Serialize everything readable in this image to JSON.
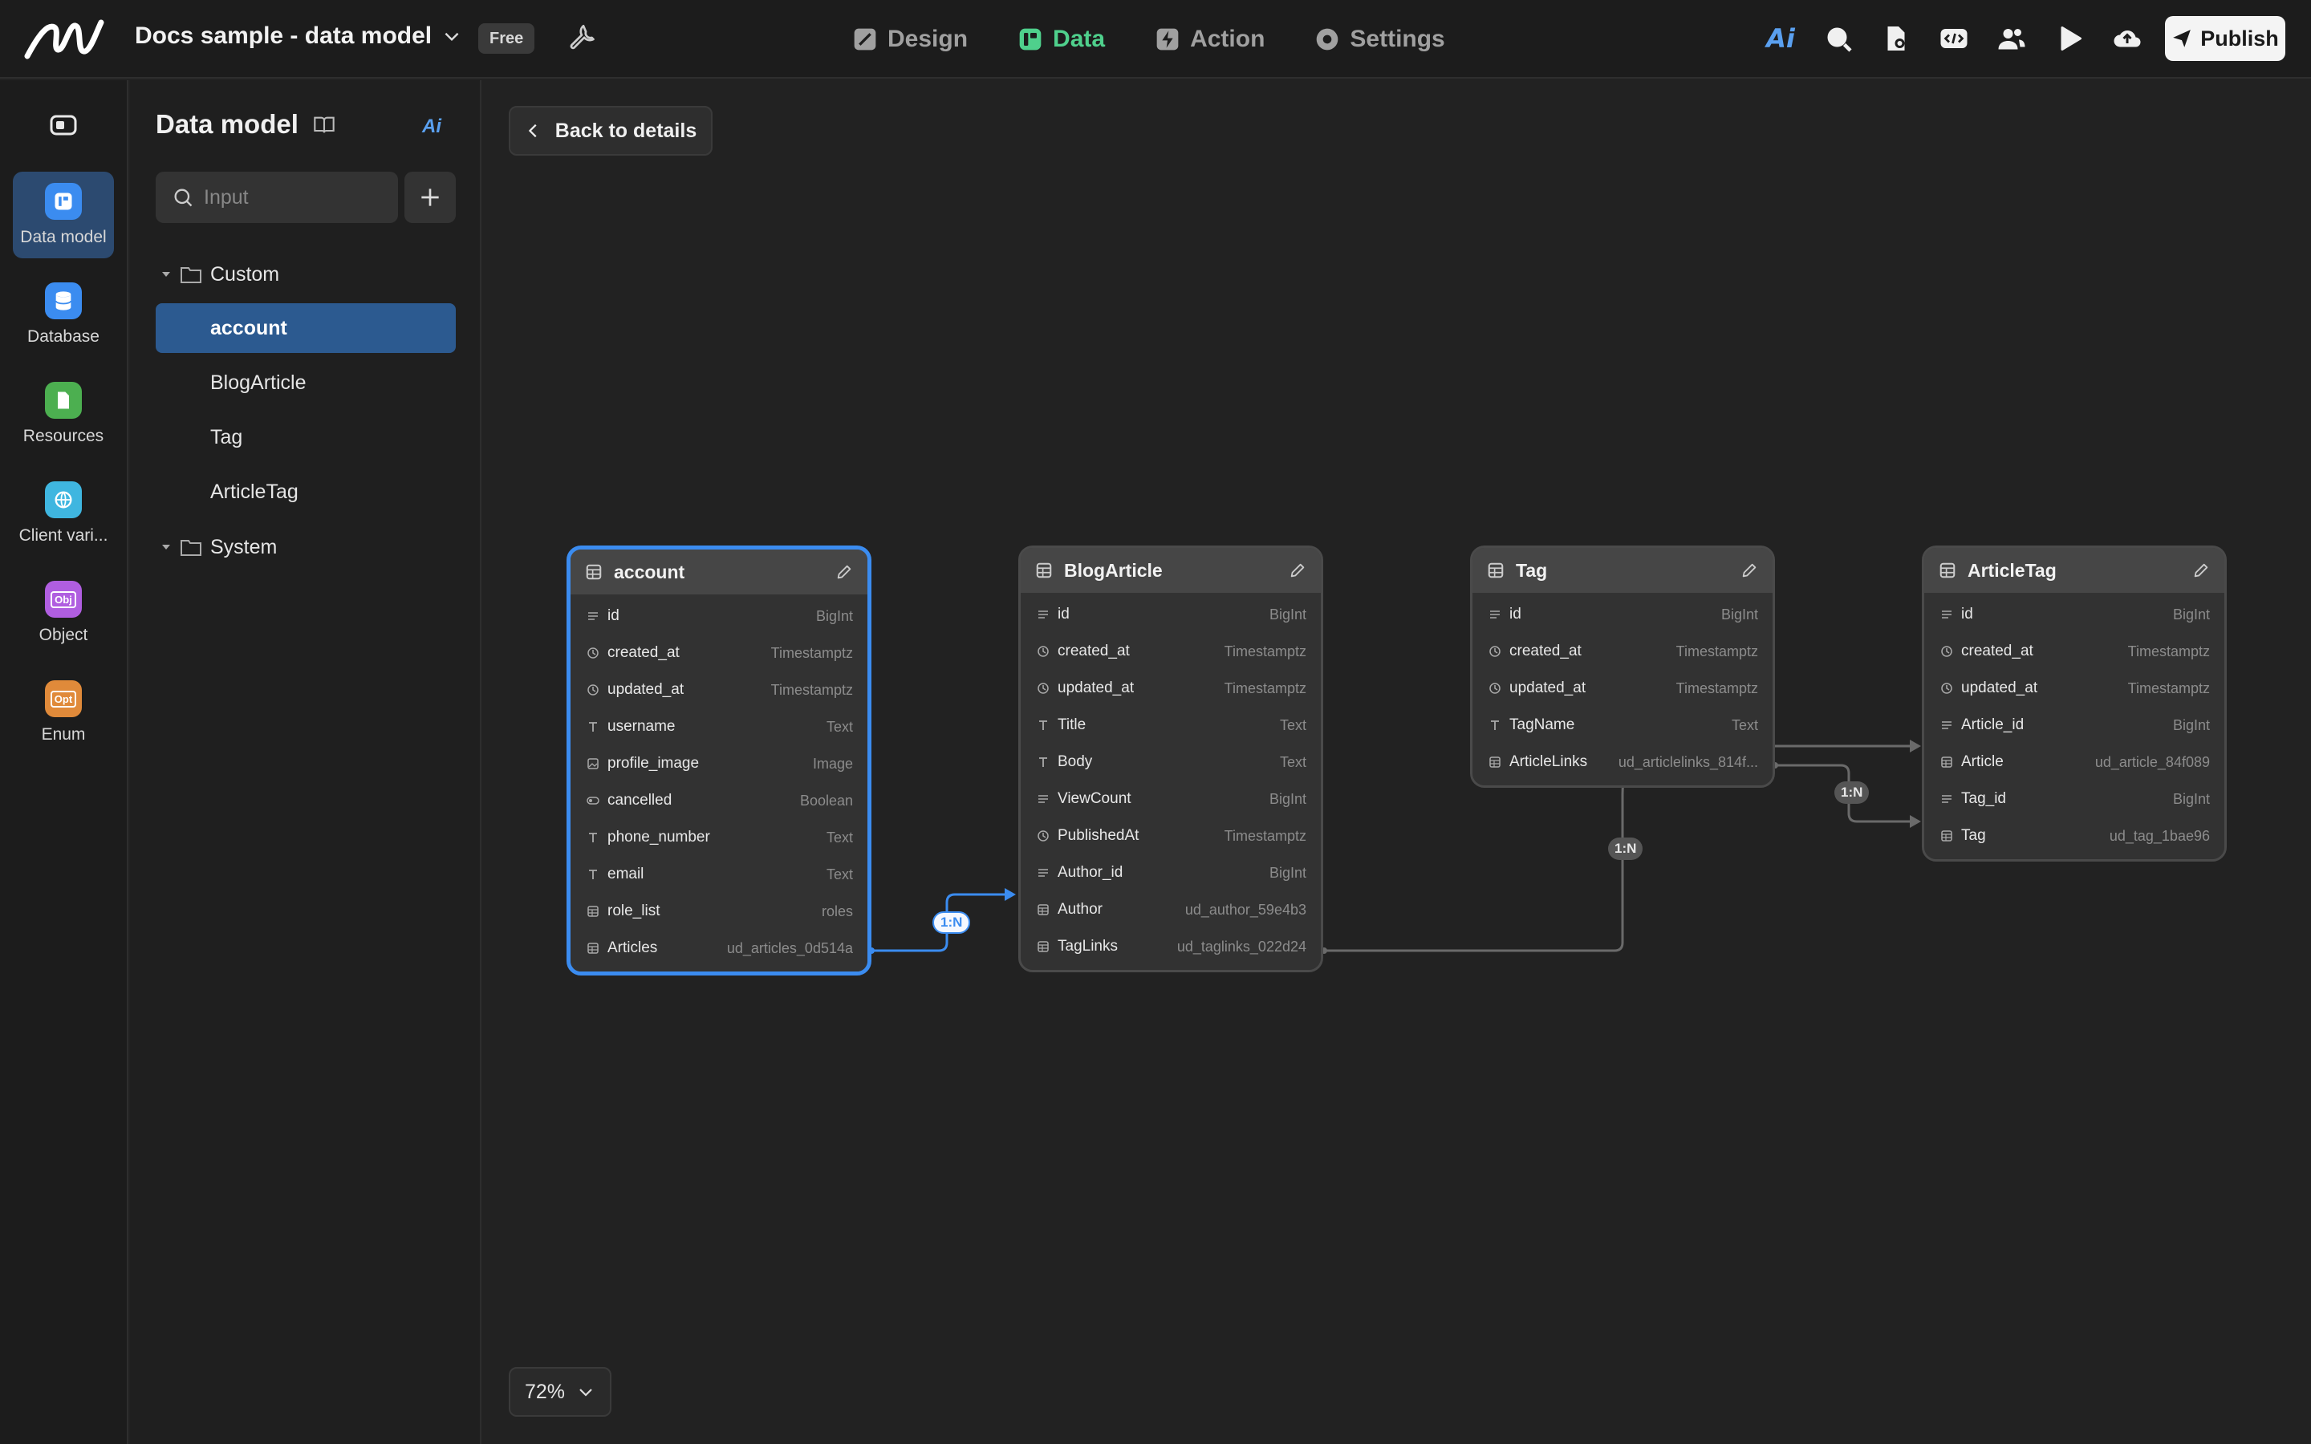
{
  "app": {
    "project_title": "Docs sample - data model",
    "plan_badge": "Free",
    "publish_label": "Publish"
  },
  "nav": {
    "tabs": [
      {
        "label": "Design",
        "icon": "brush-icon"
      },
      {
        "label": "Data",
        "icon": "data-icon",
        "active": true
      },
      {
        "label": "Action",
        "icon": "lightning-icon"
      },
      {
        "label": "Settings",
        "icon": "gear-icon"
      }
    ],
    "right_icons": [
      "ai-icon",
      "search-icon",
      "file-settings-icon",
      "code-icon",
      "users-icon",
      "play-icon",
      "cloud-icon"
    ]
  },
  "rail": {
    "items": [
      {
        "label": "Data model",
        "icon": "data-model-icon",
        "color": "#3b8cf0",
        "active": true
      },
      {
        "label": "Database",
        "icon": "database-icon",
        "color": "#3b8cf0"
      },
      {
        "label": "Resources",
        "icon": "file-icon",
        "color": "#4caf50"
      },
      {
        "label": "Client vari...",
        "icon": "globe-icon",
        "color": "#3fb6e0"
      },
      {
        "label": "Object",
        "icon": "object-icon",
        "color": "#b05ee0",
        "glyph": "Obj"
      },
      {
        "label": "Enum",
        "icon": "enum-icon",
        "color": "#e08a3a",
        "glyph": "Opt"
      }
    ]
  },
  "panel": {
    "title": "Data model",
    "search_placeholder": "Input",
    "folders": [
      {
        "label": "Custom",
        "items": [
          "account",
          "BlogArticle",
          "Tag",
          "ArticleTag"
        ],
        "selected": "account"
      },
      {
        "label": "System",
        "items": []
      }
    ]
  },
  "canvas": {
    "back_label": "Back to details",
    "zoom": "72%",
    "tables": [
      {
        "name": "account",
        "selected": true,
        "fields": [
          {
            "name": "id",
            "type": "BigInt",
            "icon": "id"
          },
          {
            "name": "created_at",
            "type": "Timestamptz",
            "icon": "clock"
          },
          {
            "name": "updated_at",
            "type": "Timestamptz",
            "icon": "clock"
          },
          {
            "name": "username",
            "type": "Text",
            "icon": "text"
          },
          {
            "name": "profile_image",
            "type": "Image",
            "icon": "image"
          },
          {
            "name": "cancelled",
            "type": "Boolean",
            "icon": "toggle"
          },
          {
            "name": "phone_number",
            "type": "Text",
            "icon": "text"
          },
          {
            "name": "email",
            "type": "Text",
            "icon": "text"
          },
          {
            "name": "role_list",
            "type": "roles",
            "icon": "table"
          },
          {
            "name": "Articles",
            "type": "ud_articles_0d514a",
            "icon": "table"
          }
        ]
      },
      {
        "name": "BlogArticle",
        "fields": [
          {
            "name": "id",
            "type": "BigInt",
            "icon": "id"
          },
          {
            "name": "created_at",
            "type": "Timestamptz",
            "icon": "clock"
          },
          {
            "name": "updated_at",
            "type": "Timestamptz",
            "icon": "clock"
          },
          {
            "name": "Title",
            "type": "Text",
            "icon": "text"
          },
          {
            "name": "Body",
            "type": "Text",
            "icon": "text"
          },
          {
            "name": "ViewCount",
            "type": "BigInt",
            "icon": "id"
          },
          {
            "name": "PublishedAt",
            "type": "Timestamptz",
            "icon": "clock"
          },
          {
            "name": "Author_id",
            "type": "BigInt",
            "icon": "id"
          },
          {
            "name": "Author",
            "type": "ud_author_59e4b3",
            "icon": "table"
          },
          {
            "name": "TagLinks",
            "type": "ud_taglinks_022d24",
            "icon": "table"
          }
        ]
      },
      {
        "name": "Tag",
        "fields": [
          {
            "name": "id",
            "type": "BigInt",
            "icon": "id"
          },
          {
            "name": "created_at",
            "type": "Timestamptz",
            "icon": "clock"
          },
          {
            "name": "updated_at",
            "type": "Timestamptz",
            "icon": "clock"
          },
          {
            "name": "TagName",
            "type": "Text",
            "icon": "text"
          },
          {
            "name": "ArticleLinks",
            "type": "ud_articlelinks_814f...",
            "icon": "table"
          }
        ]
      },
      {
        "name": "ArticleTag",
        "fields": [
          {
            "name": "id",
            "type": "BigInt",
            "icon": "id"
          },
          {
            "name": "created_at",
            "type": "Timestamptz",
            "icon": "clock"
          },
          {
            "name": "updated_at",
            "type": "Timestamptz",
            "icon": "clock"
          },
          {
            "name": "Article_id",
            "type": "BigInt",
            "icon": "id"
          },
          {
            "name": "Article",
            "type": "ud_article_84f089",
            "icon": "table"
          },
          {
            "name": "Tag_id",
            "type": "BigInt",
            "icon": "id"
          },
          {
            "name": "Tag",
            "type": "ud_tag_1bae96",
            "icon": "table"
          }
        ]
      }
    ],
    "relations": [
      {
        "label": "1:N",
        "from": "account.Articles",
        "to": "BlogArticle.Author",
        "highlighted": true
      },
      {
        "label": "1:N",
        "from": "BlogArticle.TagLinks",
        "to": "ArticleTag.Article"
      },
      {
        "label": "1:N",
        "from": "Tag.ArticleLinks",
        "to": "ArticleTag.Tag"
      }
    ]
  },
  "colors": {
    "accent": "#3b8cf0",
    "data_tab": "#4fd08c",
    "background": "#222222"
  }
}
